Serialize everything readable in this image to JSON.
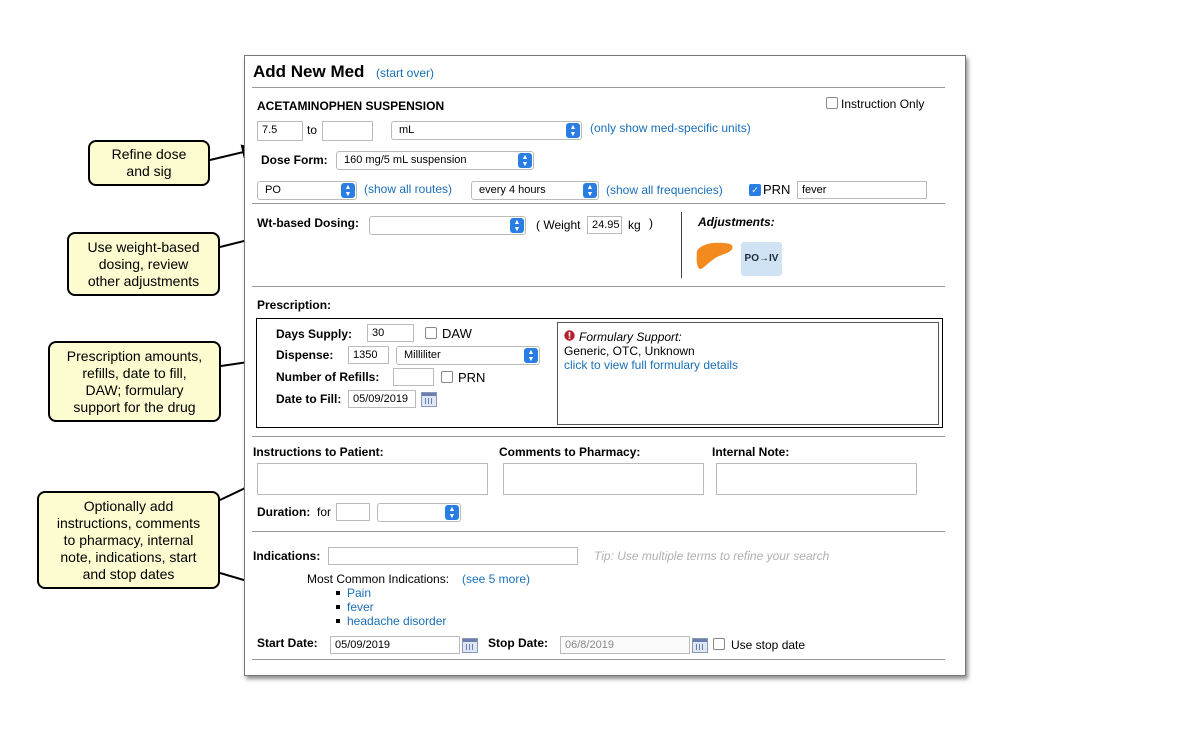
{
  "header": {
    "title": "Add New Med",
    "start_over": "(start over)"
  },
  "med": {
    "name": "ACETAMINOPHEN SUSPENSION",
    "instruction_only_label": "Instruction Only",
    "dose_from": "7.5",
    "to_label": "to",
    "dose_to": "",
    "unit": "mL",
    "unit_link": "(only show med-specific units)",
    "dose_form_label": "Dose Form:",
    "dose_form": "160 mg/5 mL suspension",
    "route": "PO",
    "route_link": "(show all routes)",
    "frequency": "every 4 hours",
    "frequency_link": "(show all frequencies)",
    "prn_label": "PRN",
    "prn_checked": true,
    "prn_reason": "fever"
  },
  "weight": {
    "label": "Wt-based Dosing:",
    "value": "",
    "weight_open": "( Weight",
    "weight_value": "24.95",
    "weight_unit": "kg",
    "weight_close": ")",
    "adjustments_label": "Adjustments:",
    "liver_icon": "liver-icon",
    "po_iv_label": "PO→IV"
  },
  "prescription": {
    "label": "Prescription:",
    "days_supply_label": "Days Supply:",
    "days_supply": "30",
    "daw_label": "DAW",
    "dispense_label": "Dispense:",
    "dispense_qty": "1350",
    "dispense_unit": "Milliliter",
    "refills_label": "Number of Refills:",
    "refills": "",
    "refills_prn_label": "PRN",
    "date_fill_label": "Date to Fill:",
    "date_fill": "05/09/2019",
    "formulary_title": "Formulary Support:",
    "formulary_status": "Generic, OTC, Unknown",
    "formulary_link": "click to view full formulary details"
  },
  "notes": {
    "instructions_label": "Instructions to Patient:",
    "comments_label": "Comments to Pharmacy:",
    "internal_label": "Internal Note:",
    "duration_label": "Duration:",
    "duration_for": "for",
    "duration_value": "",
    "duration_unit": ""
  },
  "indications": {
    "label": "Indications:",
    "placeholder": "",
    "tip": "Tip: Use multiple terms to refine your search",
    "common_label": "Most Common Indications:",
    "see_more": "(see 5 more)",
    "items": [
      "Pain",
      "fever",
      "headache disorder"
    ],
    "start_label": "Start Date:",
    "start_date": "05/09/2019",
    "stop_label": "Stop Date:",
    "stop_date": "06/8/2019",
    "use_stop_label": "Use stop date"
  },
  "callouts": [
    "Refine dose\nand sig",
    "Use weight-based\ndosing, review\nother adjustments",
    "Prescription amounts,\nrefills, date to fill,\nDAW; formulary\nsupport for the drug",
    "Optionally add\ninstructions, comments\nto pharmacy, internal\nnote, indications, start\nand stop dates"
  ],
  "colors": {
    "link": "#1a6fb8",
    "accent": "#2a7ee3",
    "callout_bg": "#fdfbd0",
    "liver": "#f28a1e"
  }
}
